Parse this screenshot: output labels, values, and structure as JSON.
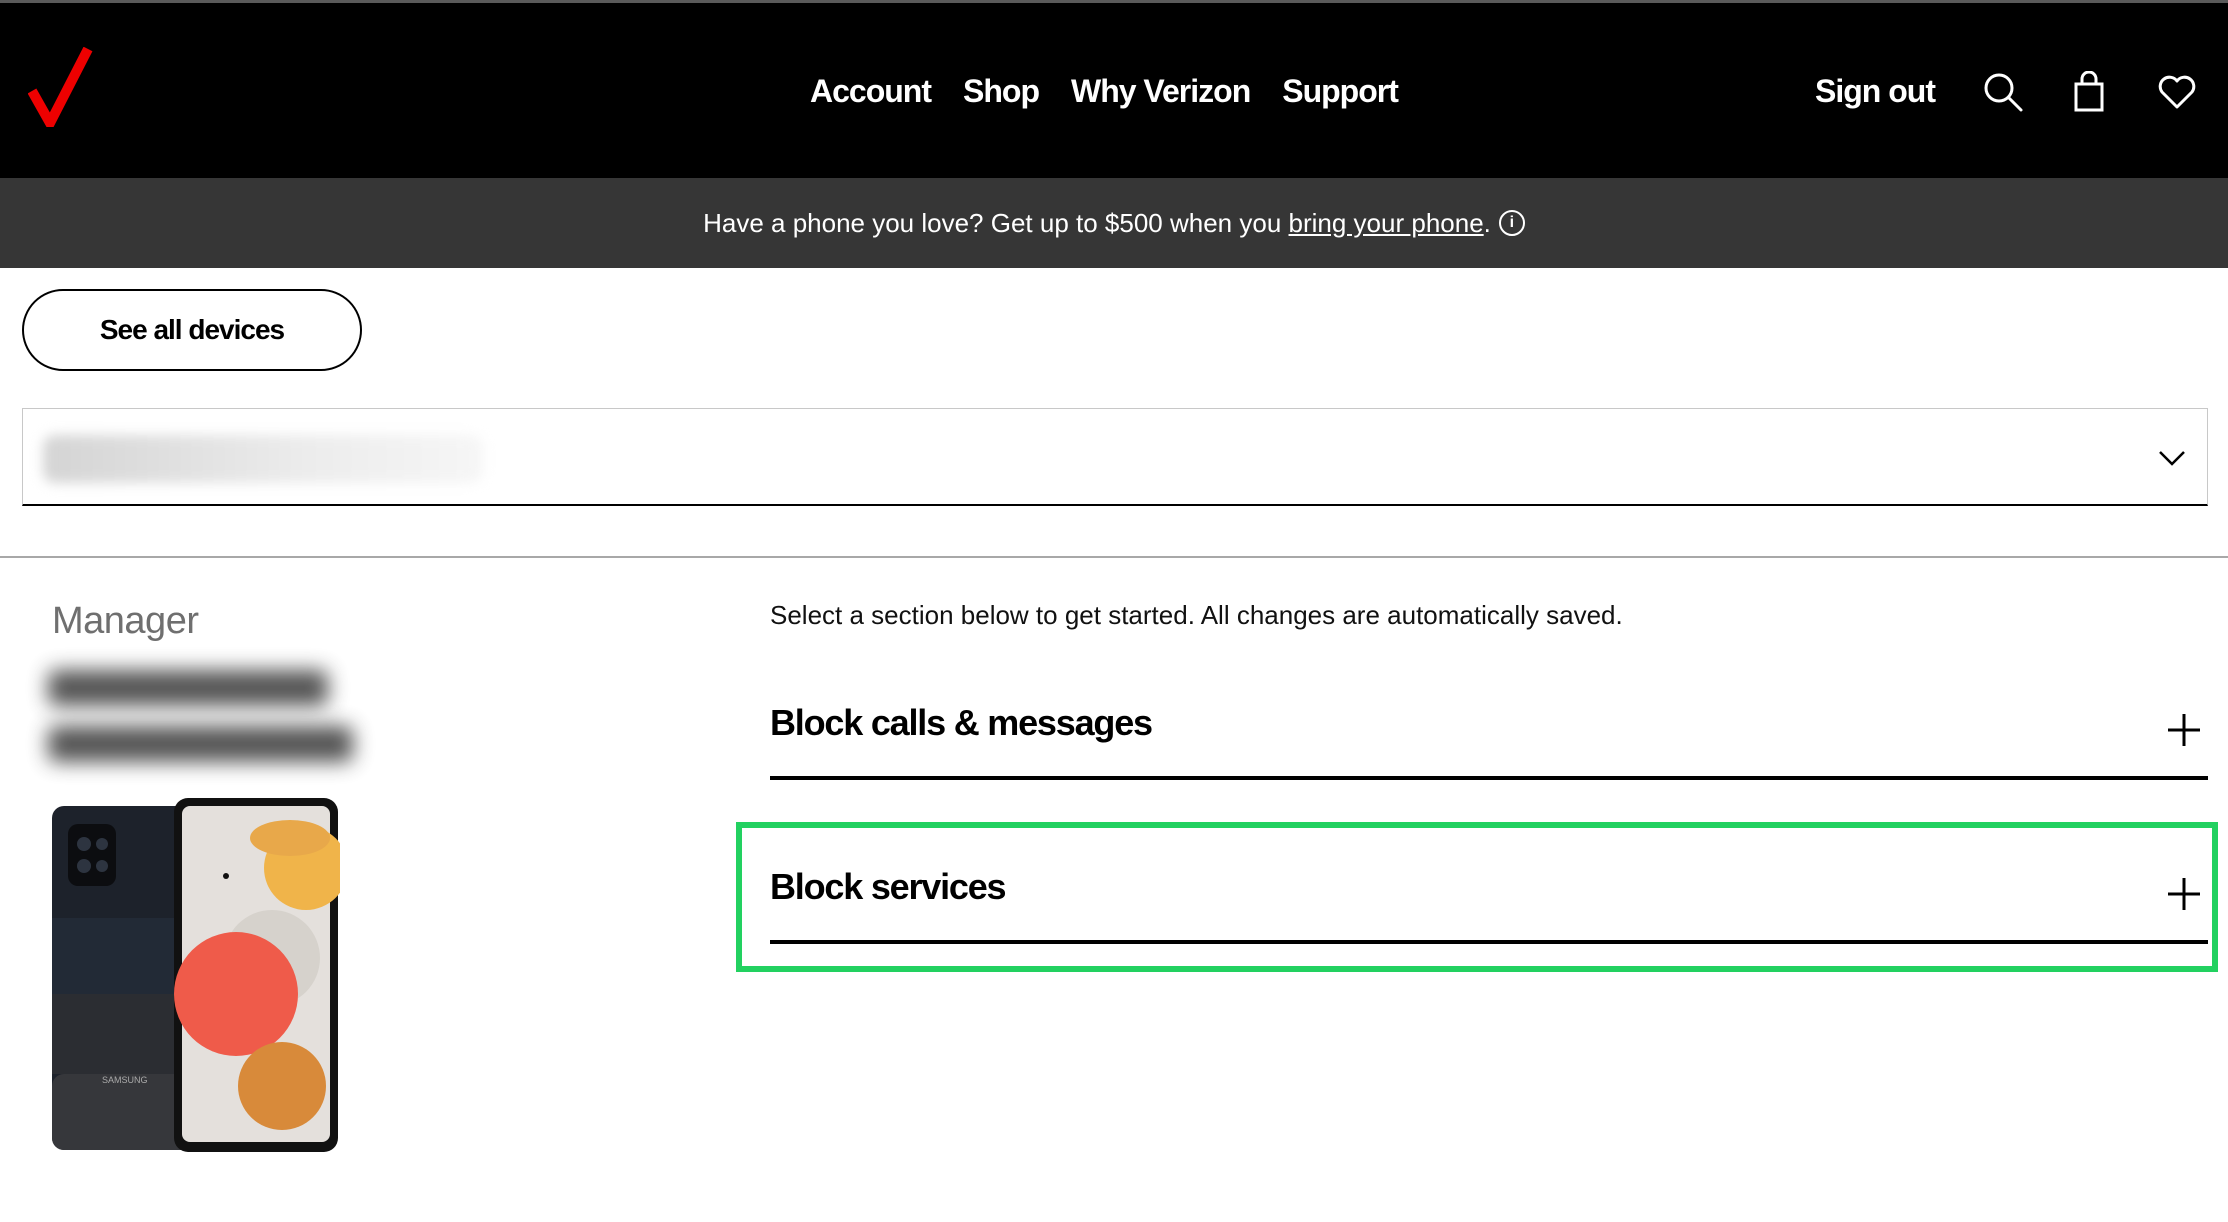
{
  "nav": {
    "links": [
      "Account",
      "Shop",
      "Why Verizon",
      "Support"
    ],
    "sign_out": "Sign out",
    "icons": [
      "search-icon",
      "shopping-bag-icon",
      "heart-icon"
    ],
    "logo_color": "#ee0000"
  },
  "promo": {
    "text_before": "Have a phone you love? Get up to $500 when you ",
    "link": "bring your phone",
    "text_after": "."
  },
  "see_all_devices": "See all devices",
  "device_select": {
    "value": "",
    "redacted": true
  },
  "device": {
    "role": "Manager",
    "brand_text": "SAMSUNG"
  },
  "main": {
    "instructions": "Select a section below to get started. All changes are automatically saved.",
    "sections": [
      {
        "title": "Block calls & messages",
        "icon": "plus-icon"
      },
      {
        "title": "Block services",
        "icon": "plus-icon",
        "highlighted": true
      }
    ]
  },
  "colors": {
    "nav_bg": "#000000",
    "promo_bg": "#363636",
    "highlight": "#22d160"
  }
}
